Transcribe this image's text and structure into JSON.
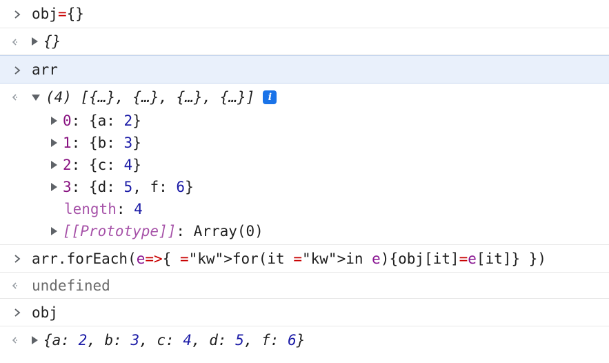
{
  "entries": [
    {
      "type": "input",
      "code": [
        "obj",
        "=",
        "{}"
      ]
    },
    {
      "type": "output",
      "value": "{}"
    },
    {
      "type": "input",
      "code": [
        "arr"
      ]
    },
    {
      "type": "output",
      "summary": "(4) [{…}, {…}, {…}, {…}]",
      "children": [
        {
          "key": "0",
          "value": "{a: 2}"
        },
        {
          "key": "1",
          "value": "{b: 3}"
        },
        {
          "key": "2",
          "value": "{c: 4}"
        },
        {
          "key": "3",
          "value": "{d: 5, f: 6}"
        },
        {
          "key": "length",
          "value": "4"
        },
        {
          "key": "[[Prototype]]",
          "value": "Array(0)"
        }
      ]
    },
    {
      "type": "input",
      "code": "arr.forEach(e=>{ for(it in e){obj[it]=e[it]} })"
    },
    {
      "type": "output",
      "value": "undefined"
    },
    {
      "type": "input",
      "code": [
        "obj"
      ]
    },
    {
      "type": "output",
      "value": "{a: 2, b: 3, c: 4, d: 5, f: 6}"
    }
  ],
  "icons": {
    "input_prompt": "chevron-right-icon",
    "output_prompt": "return-arrow-icon",
    "expand": "triangle-right-icon",
    "collapse": "triangle-down-icon",
    "info": "info-icon"
  },
  "colors": {
    "highlight_bg": "#e9f0fb",
    "number": "#1a1aa6",
    "key": "#881280",
    "keyword": "#aa0d91",
    "info_badge": "#1a73e8"
  }
}
